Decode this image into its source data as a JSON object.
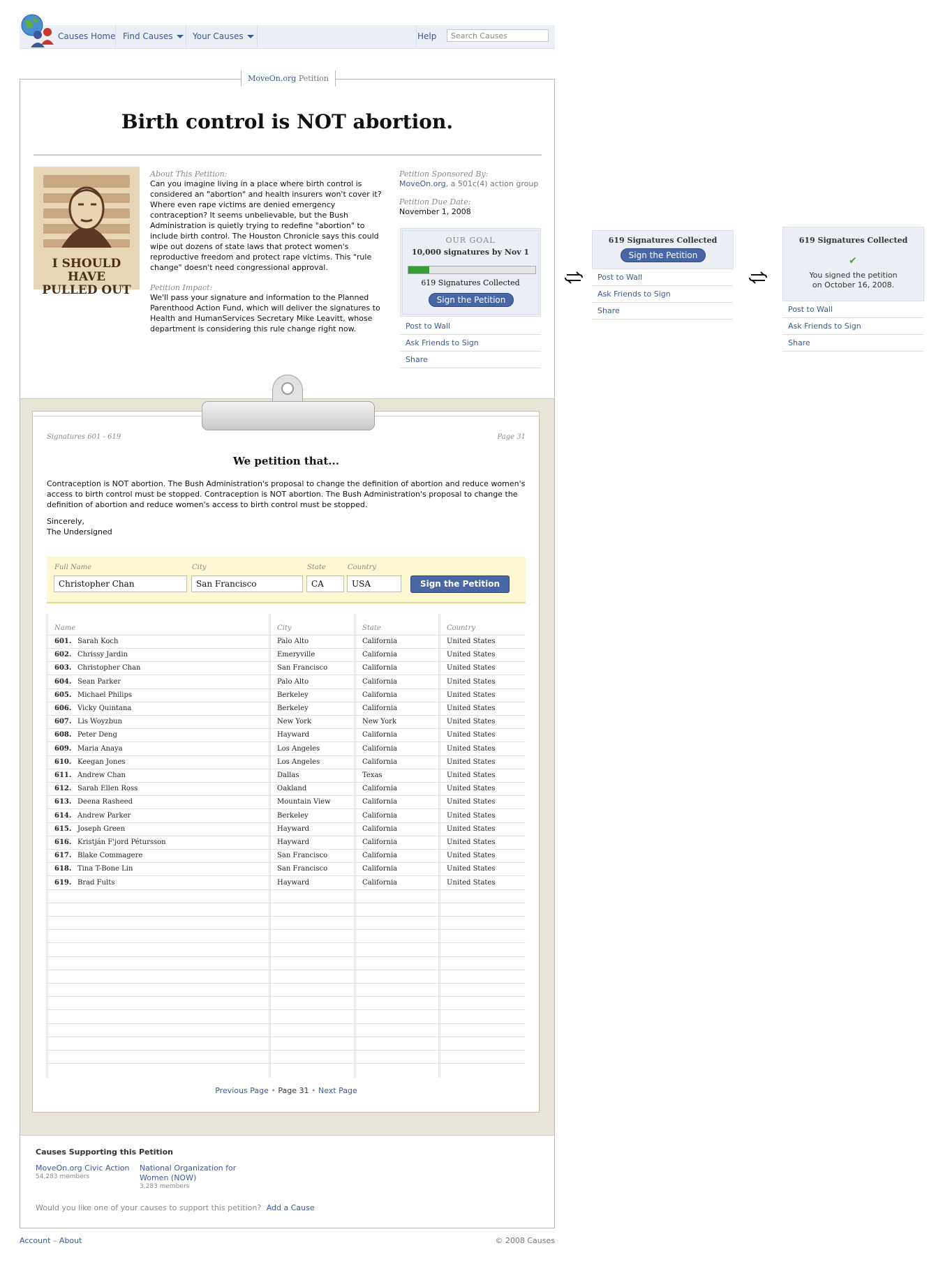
{
  "nav": {
    "home": "Causes Home",
    "find": "Find Causes",
    "yours": "Your Causes",
    "help": "Help",
    "search_placeholder": "Search Causes"
  },
  "tab": {
    "org": "MoveOn.org",
    "suffix": "Petition"
  },
  "petition": {
    "title": "Birth control is NOT abortion.",
    "poster_text_1": "I SHOULD HAVE",
    "poster_text_2": "PULLED OUT",
    "about_label": "About This Petition:",
    "about_text": "Can you imagine living in a place where birth control is considered an \"abortion\" and health insurers won't cover it? Where even rape victims are denied emergency contraception? It seems unbelievable, but the Bush Administration is quietly trying to redefine \"abortion\" to include birth control. The Houston Chronicle says this could wipe out dozens of state laws that protect women's reproductive freedom and protect rape victims. This \"rule change\" doesn't need congressional approval.",
    "impact_label": "Petition Impact:",
    "impact_text": "We'll pass your signature and information to the Planned Parenthood Action Fund, which will deliver the signatures to Health and HumanServices Secretary Mike Leavitt, whose department is considering this rule change right now.",
    "sponsor_label": "Petition Sponsored By:",
    "sponsor_org": "MoveOn.org",
    "sponsor_desc": ", a 501c(4) action group",
    "due_label": "Petition Due Date:",
    "due_date": "November 1, 2008"
  },
  "goal": {
    "heading": "OUR GOAL",
    "target": "10,000 signatures by Nov 1",
    "progress": 0.0619,
    "collected": "619 Signatures Collected",
    "sign_button": "Sign the Petition"
  },
  "actions": [
    "Post to Wall",
    "Ask Friends to Sign",
    "Share"
  ],
  "state2": {
    "collected": "619 Signatures Collected",
    "sign_button": "Sign the Petition",
    "actions": [
      "Post to Wall",
      "Ask Friends to Sign",
      "Share"
    ]
  },
  "state3": {
    "collected": "619 Signatures Collected",
    "signed_line1": "You signed the petition",
    "signed_line2": "on October 16, 2008.",
    "actions": [
      "Post to Wall",
      "Ask Friends to Sign",
      "Share"
    ]
  },
  "sheet": {
    "range": "Signatures 601 - 619",
    "page": "Page 31",
    "heading": "We petition that...",
    "text": "Contraception is NOT abortion. The Bush Administration's proposal to change the definition of abortion and reduce women's access to birth control must be stopped. Contraception is NOT abortion. The Bush Administration's proposal to change the definition of abortion and reduce women's access to birth control must be stopped.",
    "sincerely": "Sincerely,",
    "undersigned": "The Undersigned"
  },
  "form": {
    "labels": {
      "name": "Full Name",
      "city": "City",
      "state": "State",
      "country": "Country"
    },
    "values": {
      "name": "Christopher Chan",
      "city": "San Francisco",
      "state": "CA",
      "country": "USA"
    },
    "button": "Sign the Petition"
  },
  "table": {
    "headers": [
      "Name",
      "City",
      "State",
      "Country"
    ],
    "rows": [
      {
        "num": "601.",
        "name": "Sarah Koch",
        "city": "Palo Alto",
        "state": "California",
        "country": "United States"
      },
      {
        "num": "602.",
        "name": "Chrissy Jardin",
        "city": "Emeryville",
        "state": "California",
        "country": "United States"
      },
      {
        "num": "603.",
        "name": "Christopher Chan",
        "city": "San Francisco",
        "state": "California",
        "country": "United States"
      },
      {
        "num": "604.",
        "name": "Sean Parker",
        "city": "Palo Alto",
        "state": "California",
        "country": "United States"
      },
      {
        "num": "605.",
        "name": "Michael Philips",
        "city": "Berkeley",
        "state": "California",
        "country": "United States"
      },
      {
        "num": "606.",
        "name": "Vicky Quintana",
        "city": "Berkeley",
        "state": "California",
        "country": "United States"
      },
      {
        "num": "607.",
        "name": "Lis Woyzbun",
        "city": "New York",
        "state": "New York",
        "country": "United States"
      },
      {
        "num": "608.",
        "name": "Peter Deng",
        "city": "Hayward",
        "state": "California",
        "country": "United States"
      },
      {
        "num": "609.",
        "name": "Maria Anaya",
        "city": "Los Angeles",
        "state": "California",
        "country": "United States"
      },
      {
        "num": "610.",
        "name": "Keegan Jones",
        "city": "Los Angeles",
        "state": "California",
        "country": "United States"
      },
      {
        "num": "611.",
        "name": "Andrew Chan",
        "city": "Dallas",
        "state": "Texas",
        "country": "United States"
      },
      {
        "num": "612.",
        "name": "Sarah Ellen Ross",
        "city": "Oakland",
        "state": "California",
        "country": "United States"
      },
      {
        "num": "613.",
        "name": "Deena Rasheed",
        "city": "Mountain View",
        "state": "California",
        "country": "United States"
      },
      {
        "num": "614.",
        "name": "Andrew Parker",
        "city": "Berkeley",
        "state": "California",
        "country": "United States"
      },
      {
        "num": "615.",
        "name": "Joseph Green",
        "city": "Hayward",
        "state": "California",
        "country": "United States"
      },
      {
        "num": "616.",
        "name": "Kristján F'jord Pétursson",
        "city": "Hayward",
        "state": "California",
        "country": "United States"
      },
      {
        "num": "617.",
        "name": "Blake Commagere",
        "city": "San Francisco",
        "state": "California",
        "country": "United States"
      },
      {
        "num": "618.",
        "name": "Tina T-Bone Lin",
        "city": "San Francisco",
        "state": "California",
        "country": "United States"
      },
      {
        "num": "619.",
        "name": "Brad Fults",
        "city": "Hayward",
        "state": "California",
        "country": "United States"
      }
    ]
  },
  "pager": {
    "prev": "Previous Page",
    "dot": "•",
    "current": "Page 31",
    "next": "Next Page"
  },
  "supporting": {
    "heading": "Causes Supporting this Petition",
    "causes": [
      {
        "name": "MoveOn.org Civic Action",
        "members": "54,283 members"
      },
      {
        "name": "National Organization for Women (NOW)",
        "members": "3,283 members"
      }
    ],
    "question": "Would you like one of your causes to support this petition?",
    "add": "Add a Cause"
  },
  "footer": {
    "account": "Account",
    "dash": "–",
    "about": "About",
    "copyright": "© 2008 Causes"
  },
  "colors": {
    "link": "#3b5998",
    "button": "#4a67a5",
    "progress": "#33a033",
    "form_bg": "#fdf8d2",
    "clipboard_bg": "#e9e4d8"
  }
}
